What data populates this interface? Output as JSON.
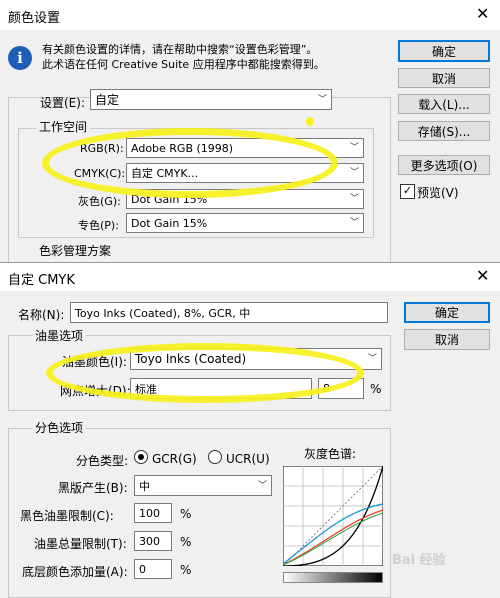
{
  "back_dialog": {
    "title": "颜色设置",
    "info_line1": "有关颜色设置的详情，请在帮助中搜索“设置色彩管理”。",
    "info_line2": "此术语在任何 Creative Suite 应用程序中都能搜索得到。",
    "settings_label": "设置(E):",
    "settings_value": "自定",
    "workspace_legend": "工作空间",
    "rgb_label": "RGB(R):",
    "rgb_value": "Adobe RGB (1998)",
    "cmyk_label": "CMYK(C):",
    "cmyk_value": "自定 CMYK...",
    "gray_label": "灰色(G):",
    "gray_value": "Dot Gain 15%",
    "spot_label": "专色(P):",
    "spot_value": "Dot Gain 15%",
    "color_mgmt_legend": "色彩管理方案",
    "ok": "确定",
    "cancel": "取消",
    "load": "载入(L)...",
    "save": "存储(S)...",
    "more_options": "更多选项(O)",
    "preview": "预览(V)"
  },
  "front_dialog": {
    "title": "自定 CMYK",
    "name_label": "名称(N):",
    "name_value": "Toyo Inks (Coated), 8%, GCR, 中",
    "ok": "确定",
    "cancel": "取消",
    "ink_legend": "油墨选项",
    "ink_colors_label": "油墨颜色(I):",
    "ink_colors_value": "Toyo Inks (Coated)",
    "dot_gain_label": "网点增大(D):",
    "dot_gain_mode": "标准",
    "dot_gain_value": "8",
    "dot_gain_unit": "%",
    "separation_legend": "分色选项",
    "sep_type_label": "分色类型:",
    "gcr_label": "GCR(G)",
    "ucr_label": "UCR(U)",
    "black_gen_label": "黑版产生(B):",
    "black_gen_value": "中",
    "black_limit_label": "黑色油墨限制(C):",
    "black_limit_value": "100",
    "total_limit_label": "油墨总量限制(T):",
    "total_limit_value": "300",
    "ucr_add_label": "底层颜色添加量(A):",
    "ucr_add_value": "0",
    "percent": "%",
    "gray_ramp_label": "灰度色谱:"
  },
  "watermark": "Bai 经验",
  "colors": {
    "accent": "#0078d7",
    "highlight": "#f7f01b",
    "cyan_curve": "#1e9bd7",
    "red_curve": "#e8402a"
  }
}
